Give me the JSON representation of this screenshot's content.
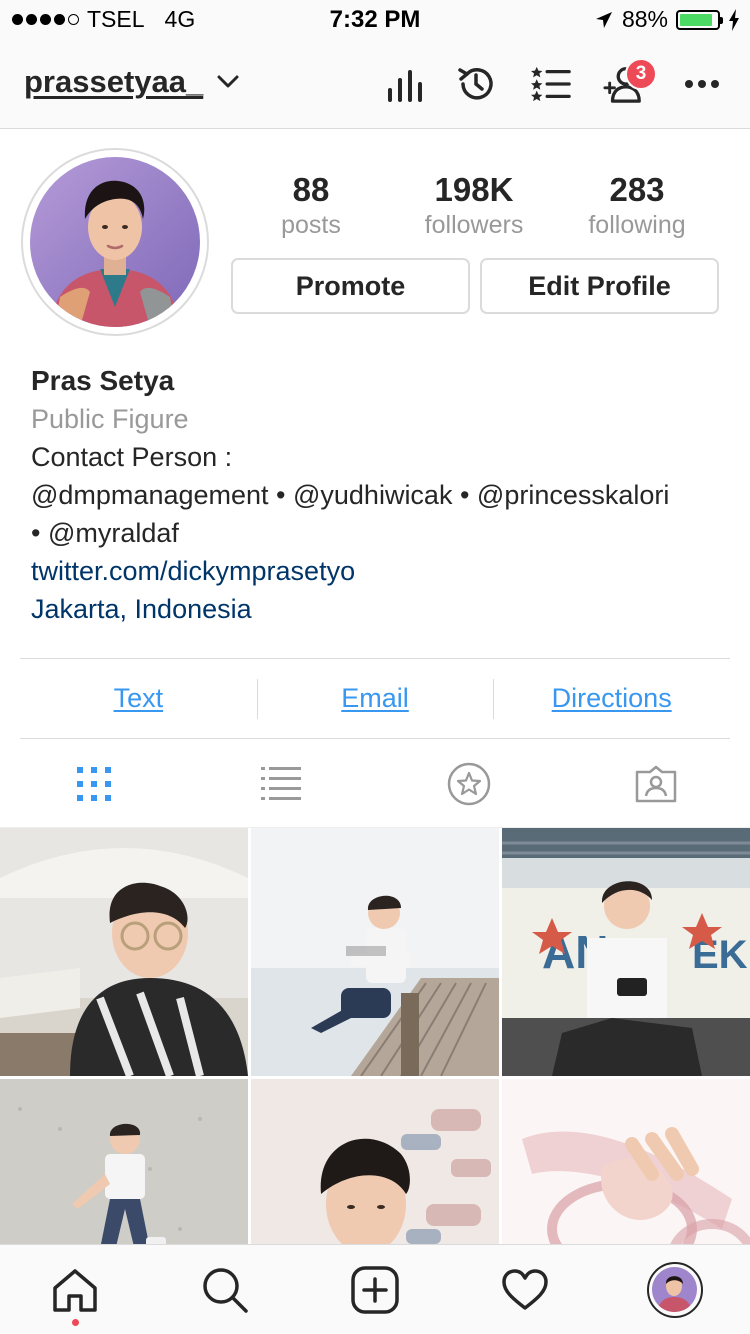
{
  "status_bar": {
    "carrier": "TSEL",
    "network": "4G",
    "time": "7:32 PM",
    "battery_pct": "88%",
    "battery_level": 0.88,
    "colors": {
      "battery": "#4cd964"
    }
  },
  "nav": {
    "username": "prassetyaa_",
    "notification_count": "3",
    "icons": [
      "chevron-down-icon",
      "insights-icon",
      "activity-history-icon",
      "close-friends-list-icon",
      "add-user-icon",
      "more-icon"
    ]
  },
  "stats": [
    {
      "value": "88",
      "label": "posts"
    },
    {
      "value": "198K",
      "label": "followers"
    },
    {
      "value": "283",
      "label": "following"
    }
  ],
  "buttons": {
    "promote": "Promote",
    "edit_profile": "Edit Profile"
  },
  "bio": {
    "name": "Pras Setya",
    "category": "Public Figure",
    "line1": "Contact Person :",
    "line2": "@dmpmanagement • @yudhiwicak • @princesskalori",
    "line3": "• @myraldaf",
    "link": "twitter.com/dickymprasetyo",
    "location": "Jakarta, Indonesia"
  },
  "contact": {
    "text": "Text",
    "email": "Email",
    "directions": "Directions"
  },
  "view_tabs": [
    "grid-icon",
    "list-icon",
    "saved-star-icon",
    "tagged-icon"
  ],
  "tab_bar": [
    "home-icon",
    "search-icon",
    "new-post-icon",
    "heart-icon",
    "profile-avatar"
  ],
  "colors": {
    "link_blue": "#3897f0",
    "bio_link": "#003569",
    "badge_red": "#ed4956",
    "border": "#dbdbdb"
  }
}
